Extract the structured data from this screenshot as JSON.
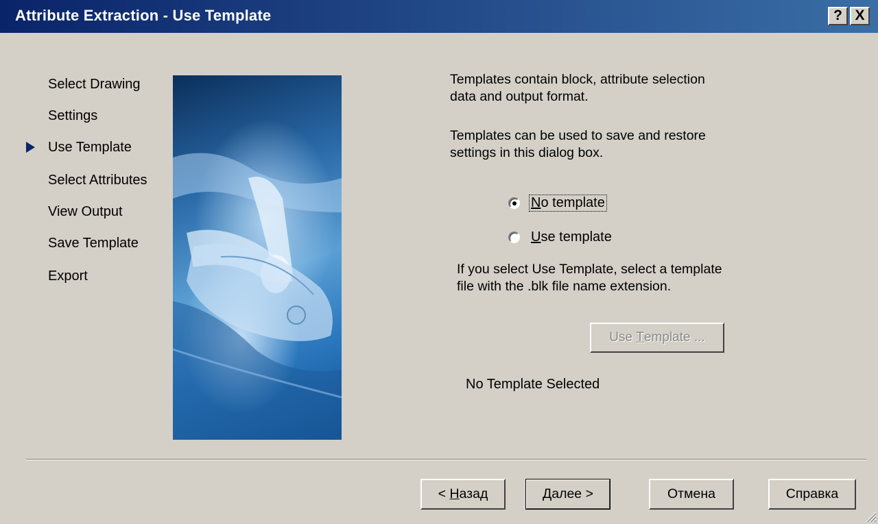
{
  "window": {
    "title": "Attribute Extraction - Use Template",
    "help_glyph": "?",
    "close_glyph": "X"
  },
  "steps": {
    "current_index": 2,
    "items": [
      {
        "label": "Select Drawing"
      },
      {
        "label": "Settings"
      },
      {
        "label": "Use Template"
      },
      {
        "label": "Select Attributes"
      },
      {
        "label": "View Output"
      },
      {
        "label": "Save Template"
      },
      {
        "label": "Export"
      }
    ]
  },
  "content": {
    "intro_line1": "Templates contain block, attribute selection",
    "intro_line2": "data and output format.",
    "intro2_line1": "Templates can be used to save and restore",
    "intro2_line2": "settings in this dialog box.",
    "radio_no_template": {
      "mnemonic": "N",
      "rest": "o template",
      "checked": true
    },
    "radio_use_template": {
      "mnemonic": "U",
      "rest": "se template",
      "checked": false
    },
    "hint_line1": "If you select Use Template, select a template",
    "hint_line2": "file with the .blk file name extension.",
    "use_template_button": {
      "before": "Use ",
      "mnemonic": "T",
      "after": "emplate ...",
      "enabled": false
    },
    "status": "No Template Selected"
  },
  "footer": {
    "back": {
      "prefix": "< ",
      "mnemonic": "Н",
      "rest": "азад"
    },
    "next_label": "Далее >",
    "cancel_label": "Отмена",
    "help_label": "Справка"
  },
  "colors": {
    "titlebar_start": "#0a246a",
    "titlebar_end": "#3a6ea5",
    "dialog_bg": "#d4d0c8",
    "step_arrow": "#0a246a"
  }
}
